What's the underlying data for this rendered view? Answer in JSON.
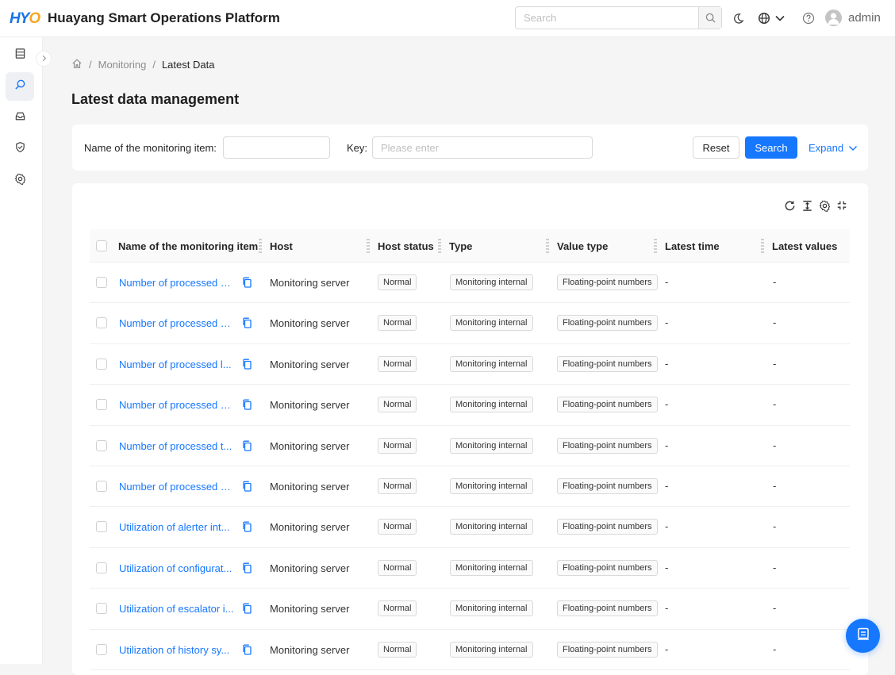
{
  "header": {
    "logo_part1": "HY",
    "logo_part2": "O",
    "title": "Huayang Smart Operations Platform",
    "search_placeholder": "Search",
    "username": "admin"
  },
  "icons": {
    "sidebar": [
      "table-icon",
      "monitor-search-icon",
      "inbox-icon",
      "shield-check-icon",
      "gear-icon"
    ],
    "header": [
      "search-icon",
      "moon-icon",
      "globe-icon",
      "chevron-down-icon",
      "help-icon",
      "avatar"
    ]
  },
  "breadcrumb": {
    "items": [
      "Monitoring",
      "Latest Data"
    ]
  },
  "page_title": "Latest data management",
  "filter": {
    "name_label": "Name of the monitoring item",
    "name_value": "",
    "key_label": "Key",
    "key_placeholder": "Please enter",
    "reset_label": "Reset",
    "search_label": "Search",
    "expand_label": "Expand"
  },
  "table": {
    "columns": [
      "Name of the monitoring item",
      "Host",
      "Host status",
      "Type",
      "Value type",
      "Latest time",
      "Latest values"
    ],
    "rows": [
      {
        "name": "Number of processed n...",
        "host": "Monitoring server",
        "status": "Normal",
        "type": "Monitoring internal",
        "value_type": "Floating-point numbers",
        "time": "-",
        "value": "-"
      },
      {
        "name": "Number of processed c...",
        "host": "Monitoring server",
        "status": "Normal",
        "type": "Monitoring internal",
        "value_type": "Floating-point numbers",
        "time": "-",
        "value": "-"
      },
      {
        "name": "Number of processed l...",
        "host": "Monitoring server",
        "status": "Normal",
        "type": "Monitoring internal",
        "value_type": "Floating-point numbers",
        "time": "-",
        "value": "-"
      },
      {
        "name": "Number of processed n...",
        "host": "Monitoring server",
        "status": "Normal",
        "type": "Monitoring internal",
        "value_type": "Floating-point numbers",
        "time": "-",
        "value": "-"
      },
      {
        "name": "Number of processed t...",
        "host": "Monitoring server",
        "status": "Normal",
        "type": "Monitoring internal",
        "value_type": "Floating-point numbers",
        "time": "-",
        "value": "-"
      },
      {
        "name": "Number of processed n...",
        "host": "Monitoring server",
        "status": "Normal",
        "type": "Monitoring internal",
        "value_type": "Floating-point numbers",
        "time": "-",
        "value": "-"
      },
      {
        "name": "Utilization of alerter int...",
        "host": "Monitoring server",
        "status": "Normal",
        "type": "Monitoring internal",
        "value_type": "Floating-point numbers",
        "time": "-",
        "value": "-"
      },
      {
        "name": "Utilization of configurat...",
        "host": "Monitoring server",
        "status": "Normal",
        "type": "Monitoring internal",
        "value_type": "Floating-point numbers",
        "time": "-",
        "value": "-"
      },
      {
        "name": "Utilization of escalator i...",
        "host": "Monitoring server",
        "status": "Normal",
        "type": "Monitoring internal",
        "value_type": "Floating-point numbers",
        "time": "-",
        "value": "-"
      },
      {
        "name": "Utilization of history sy...",
        "host": "Monitoring server",
        "status": "Normal",
        "type": "Monitoring internal",
        "value_type": "Floating-point numbers",
        "time": "-",
        "value": "-"
      }
    ]
  },
  "colors": {
    "accent": "#1677ff",
    "logo_blue": "#1a73e8",
    "logo_orange": "#f5a623"
  }
}
